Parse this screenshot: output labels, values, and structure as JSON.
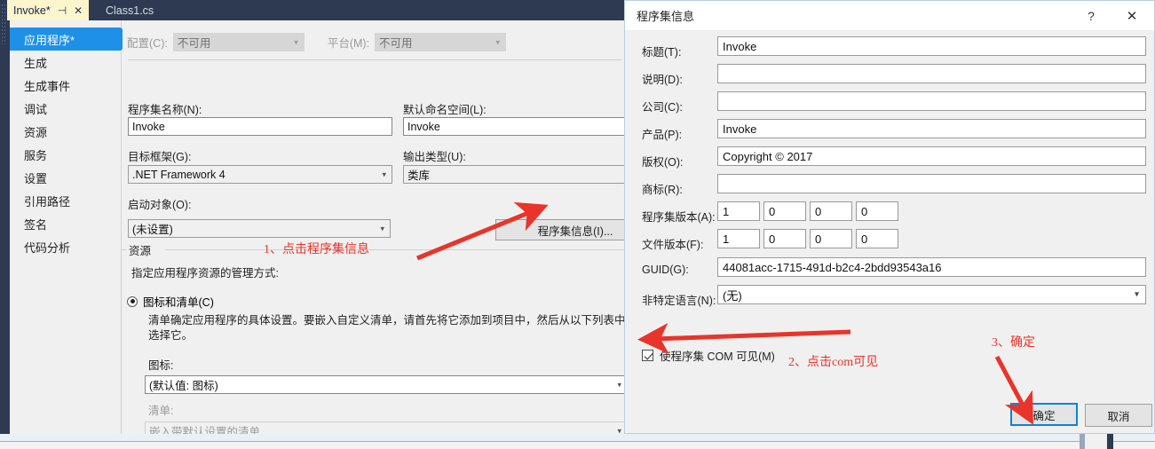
{
  "ide": {
    "tabs": [
      {
        "label": "Invoke*",
        "active": true,
        "pin_icon": "pin-icon",
        "close_icon": "close-icon"
      },
      {
        "label": "Class1.cs",
        "active": false
      }
    ],
    "sidebar": {
      "items": [
        {
          "label": "应用程序*",
          "selected": true
        },
        {
          "label": "生成",
          "selected": false
        },
        {
          "label": "生成事件",
          "selected": false
        },
        {
          "label": "调试",
          "selected": false
        },
        {
          "label": "资源",
          "selected": false
        },
        {
          "label": "服务",
          "selected": false
        },
        {
          "label": "设置",
          "selected": false
        },
        {
          "label": "引用路径",
          "selected": false
        },
        {
          "label": "签名",
          "selected": false
        },
        {
          "label": "代码分析",
          "selected": false
        }
      ]
    },
    "app_page": {
      "config_label": "配置(C):",
      "config_value": "不可用",
      "platform_label": "平台(M):",
      "platform_value": "不可用",
      "assembly_name_label": "程序集名称(N):",
      "assembly_name_value": "Invoke",
      "default_namespace_label": "默认命名空间(L):",
      "default_namespace_value": "Invoke",
      "target_framework_label": "目标框架(G):",
      "target_framework_value": ".NET Framework 4",
      "output_type_label": "输出类型(U):",
      "output_type_value": "类库",
      "startup_object_label": "启动对象(O):",
      "startup_object_value": "(未设置)",
      "assembly_info_button": "程序集信息(I)...",
      "resources_group_title": "资源",
      "resources_hint": "指定应用程序资源的管理方式:",
      "icon_manifest_radio": "图标和清单(C)",
      "icon_manifest_desc": "清单确定应用程序的具体设置。要嵌入自定义清单，请首先将它添加到项目中，然后从以下列表中选择它。",
      "icon_label": "图标:",
      "icon_value": "(默认值: 图标)",
      "manifest_label": "清单:",
      "manifest_value": "嵌入带默认设置的清单"
    }
  },
  "dialog": {
    "title": "程序集信息",
    "help_icon": "help-icon",
    "close_icon": "close-icon",
    "fields": [
      {
        "label": "标题(T):",
        "value": "Invoke"
      },
      {
        "label": "说明(D):",
        "value": ""
      },
      {
        "label": "公司(C):",
        "value": ""
      },
      {
        "label": "产品(P):",
        "value": "Invoke"
      },
      {
        "label": "版权(O):",
        "value": "Copyright ©  2017"
      },
      {
        "label": "商标(R):",
        "value": ""
      }
    ],
    "assembly_version_label": "程序集版本(A):",
    "assembly_version": [
      "1",
      "0",
      "0",
      "0"
    ],
    "file_version_label": "文件版本(F):",
    "file_version": [
      "1",
      "0",
      "0",
      "0"
    ],
    "guid_label": "GUID(G):",
    "guid_value": "44081acc-1715-491d-b2c4-2bdd93543a16",
    "neutral_language_label": "非特定语言(N):",
    "neutral_language_value": "(无)",
    "com_visible_label": "使程序集 COM 可见(M)",
    "com_visible_checked": true,
    "ok_button": "确定",
    "cancel_button": "取消"
  },
  "annotations": {
    "step1": "1、点击程序集信息",
    "step2": "2、点击com可见",
    "step3": "3、确定",
    "color": "#e8342a"
  }
}
